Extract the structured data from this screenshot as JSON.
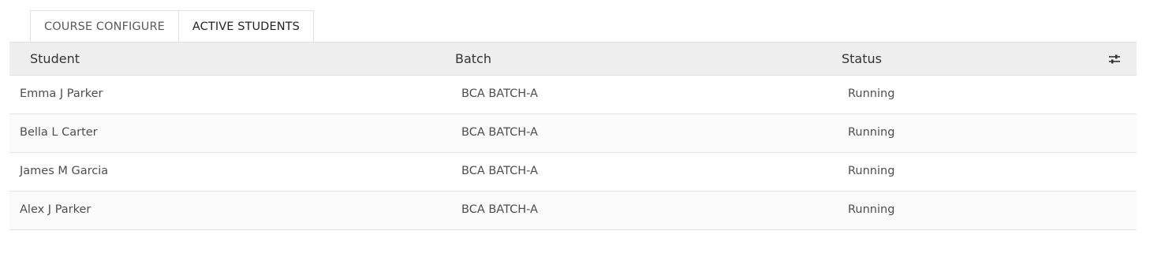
{
  "tabs": [
    {
      "label": "COURSE CONFIGURE"
    },
    {
      "label": "ACTIVE STUDENTS"
    }
  ],
  "table": {
    "headers": {
      "student": "Student",
      "batch": "Batch",
      "status": "Status"
    },
    "settings_icon": "sliders-icon",
    "rows": [
      {
        "student": "Emma J Parker",
        "batch": "BCA BATCH-A",
        "status": "Running"
      },
      {
        "student": "Bella L Carter",
        "batch": "BCA BATCH-A",
        "status": "Running"
      },
      {
        "student": "James M Garcia",
        "batch": "BCA BATCH-A",
        "status": "Running"
      },
      {
        "student": "Alex J Parker",
        "batch": "BCA BATCH-A",
        "status": "Running"
      }
    ]
  }
}
